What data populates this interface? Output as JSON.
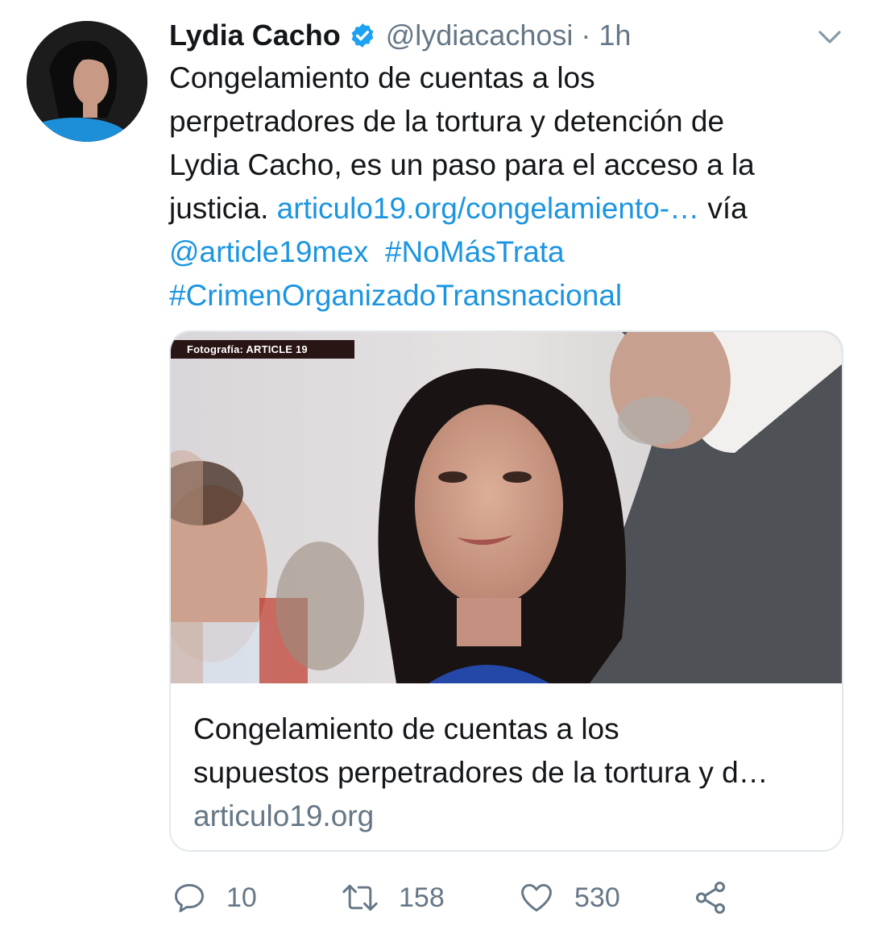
{
  "tweet": {
    "author_name": "Lydia Cacho",
    "handle": "@lydiacachosi",
    "separator": "·",
    "time": "1h",
    "text": {
      "line1": "Congelamiento de cuentas a los",
      "line2": "perpetradores de la tortura y detención de",
      "line3": "Lydia Cacho, es un paso para el acceso a la",
      "line4_plain": "justicia. ",
      "link": "articulo19.org/congelamiento-…",
      "line4_after": " vía",
      "mention": "@article19mex",
      "hashtag1": "#NoMásTrata",
      "hashtag2": "#CrimenOrganizadoTransnacional"
    },
    "card": {
      "photo_credit": "Fotografía: ARTICLE 19",
      "title_line1": "Congelamiento de cuentas a los",
      "title_line2": "supuestos perpetradores de la tortura y d…",
      "domain": "articulo19.org"
    },
    "actions": {
      "replies": "10",
      "retweets": "158",
      "likes": "530"
    }
  },
  "icons": {
    "verified": "verified-badge-icon",
    "caret": "chevron-down-icon",
    "reply": "reply-icon",
    "retweet": "retweet-icon",
    "like": "heart-icon",
    "share": "share-icon"
  },
  "colors": {
    "link": "#1b95e0",
    "secondary_text": "#657786",
    "primary_text": "#14171a",
    "verified": "#1da1f2",
    "card_border": "#e1e8ed"
  }
}
